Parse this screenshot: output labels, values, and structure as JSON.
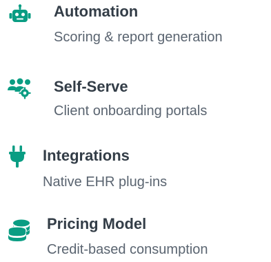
{
  "colors": {
    "accent": "#0a9d83",
    "title": "#333d47",
    "subtitle": "#5a6470"
  },
  "features": [
    {
      "icon": "robot-icon",
      "title": "Automation",
      "subtitle": "Scoring & report generation"
    },
    {
      "icon": "users-gear-icon",
      "title": "Self-Serve",
      "subtitle": "Client onboarding portals"
    },
    {
      "icon": "plug-icon",
      "title": "Integrations",
      "subtitle": "Native EHR plug-ins"
    },
    {
      "icon": "coins-icon",
      "title": "Pricing Model",
      "subtitle": "Credit-based consumption"
    }
  ]
}
